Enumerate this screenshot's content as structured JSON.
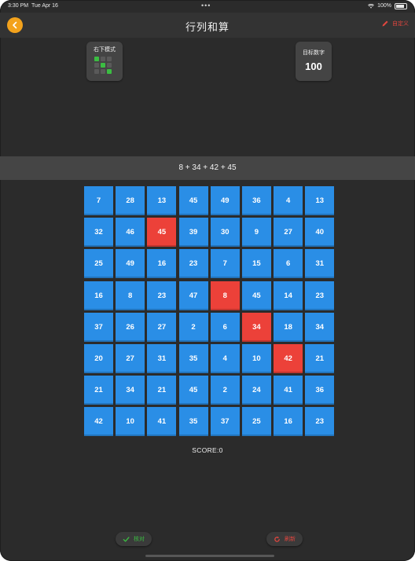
{
  "status": {
    "time": "3:30 PM",
    "date": "Tue Apr 16",
    "center_dots": "•••",
    "battery": "100%"
  },
  "nav": {
    "title": "行列和算",
    "right_label": "自定义"
  },
  "mode": {
    "label": "右下模式",
    "cells": [
      1,
      0,
      0,
      0,
      1,
      0,
      0,
      0,
      1
    ]
  },
  "target": {
    "label": "目标数字",
    "value": "100"
  },
  "equation": "8 + 34 + 42 + 45",
  "grid": {
    "rows": [
      [
        "7",
        "28",
        "13",
        "45",
        "49",
        "36",
        "4",
        "13"
      ],
      [
        "32",
        "46",
        "45",
        "39",
        "30",
        "9",
        "27",
        "40"
      ],
      [
        "25",
        "49",
        "16",
        "23",
        "7",
        "15",
        "6",
        "31"
      ],
      [
        "16",
        "8",
        "23",
        "47",
        "8",
        "45",
        "14",
        "23"
      ],
      [
        "37",
        "26",
        "27",
        "2",
        "6",
        "34",
        "18",
        "34"
      ],
      [
        "20",
        "27",
        "31",
        "35",
        "4",
        "10",
        "42",
        "21"
      ],
      [
        "21",
        "34",
        "21",
        "45",
        "2",
        "24",
        "41",
        "36"
      ],
      [
        "42",
        "10",
        "41",
        "35",
        "37",
        "25",
        "16",
        "23"
      ]
    ],
    "selected": [
      [
        1,
        2
      ],
      [
        3,
        4
      ],
      [
        4,
        5
      ],
      [
        5,
        6
      ]
    ],
    "colors": {
      "normal": "#2a8ee6",
      "selected": "#ec4139"
    }
  },
  "score": "SCORE:0",
  "buttons": {
    "check": "核对",
    "refresh": "刷新"
  },
  "icons": {
    "back": "chevron-left-icon",
    "edit": "pencil-icon",
    "check": "checkmark-icon",
    "refresh": "refresh-icon"
  }
}
